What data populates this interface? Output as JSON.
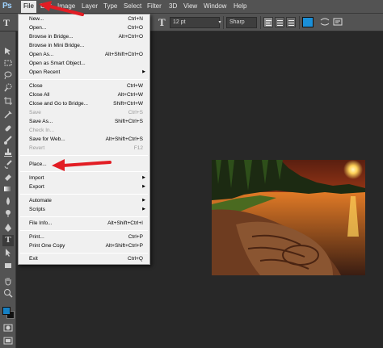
{
  "app": {
    "logo": "Ps"
  },
  "menubar": [
    {
      "label": "File",
      "open": true
    },
    {
      "label": "Edit"
    },
    {
      "label": "Image"
    },
    {
      "label": "Layer"
    },
    {
      "label": "Type"
    },
    {
      "label": "Select"
    },
    {
      "label": "Filter"
    },
    {
      "label": "3D"
    },
    {
      "label": "View"
    },
    {
      "label": "Window"
    },
    {
      "label": "Help"
    }
  ],
  "options": {
    "tool_glyph": "T",
    "font_size": "12 pt",
    "antialias": "Sharp",
    "text_color": "#1a8fd8"
  },
  "file_menu": [
    {
      "label": "New...",
      "shortcut": "Ctrl+N"
    },
    {
      "label": "Open...",
      "shortcut": "Ctrl+O"
    },
    {
      "label": "Browse in Bridge...",
      "shortcut": "Alt+Ctrl+O"
    },
    {
      "label": "Browse in Mini Bridge..."
    },
    {
      "label": "Open As...",
      "shortcut": "Alt+Shift+Ctrl+O"
    },
    {
      "label": "Open as Smart Object..."
    },
    {
      "label": "Open Recent",
      "submenu": true
    },
    {
      "separator": true
    },
    {
      "label": "Close",
      "shortcut": "Ctrl+W"
    },
    {
      "label": "Close All",
      "shortcut": "Alt+Ctrl+W"
    },
    {
      "label": "Close and Go to Bridge...",
      "shortcut": "Shift+Ctrl+W"
    },
    {
      "label": "Save",
      "shortcut": "Ctrl+S",
      "disabled": true
    },
    {
      "label": "Save As...",
      "shortcut": "Shift+Ctrl+S"
    },
    {
      "label": "Check In...",
      "disabled": true
    },
    {
      "label": "Save for Web...",
      "shortcut": "Alt+Shift+Ctrl+S"
    },
    {
      "label": "Revert",
      "shortcut": "F12",
      "disabled": true
    },
    {
      "separator": true
    },
    {
      "label": "Place..."
    },
    {
      "separator": true
    },
    {
      "label": "Import",
      "submenu": true
    },
    {
      "label": "Export",
      "submenu": true
    },
    {
      "separator": true
    },
    {
      "label": "Automate",
      "submenu": true
    },
    {
      "label": "Scripts",
      "submenu": true
    },
    {
      "separator": true
    },
    {
      "label": "File Info...",
      "shortcut": "Alt+Shift+Ctrl+I"
    },
    {
      "separator": true
    },
    {
      "label": "Print...",
      "shortcut": "Ctrl+P"
    },
    {
      "label": "Print One Copy",
      "shortcut": "Alt+Shift+Ctrl+P"
    },
    {
      "separator": true
    },
    {
      "label": "Exit",
      "shortcut": "Ctrl+Q"
    }
  ],
  "tools": [
    "move-tool-icon",
    "marquee-tool-icon",
    "lasso-tool-icon",
    "quick-select-tool-icon",
    "crop-tool-icon",
    "eyedropper-tool-icon",
    "spot-healing-tool-icon",
    "brush-tool-icon",
    "clone-stamp-tool-icon",
    "history-brush-tool-icon",
    "eraser-tool-icon",
    "gradient-tool-icon",
    "blur-tool-icon",
    "dodge-tool-icon",
    "pen-tool-icon",
    "type-tool-icon",
    "path-select-tool-icon",
    "rectangle-tool-icon",
    "hand-tool-icon",
    "zoom-tool-icon"
  ],
  "colors": {
    "foreground": "#1580c4",
    "background": "#111111",
    "highlight_arrow": "#e21d24"
  }
}
